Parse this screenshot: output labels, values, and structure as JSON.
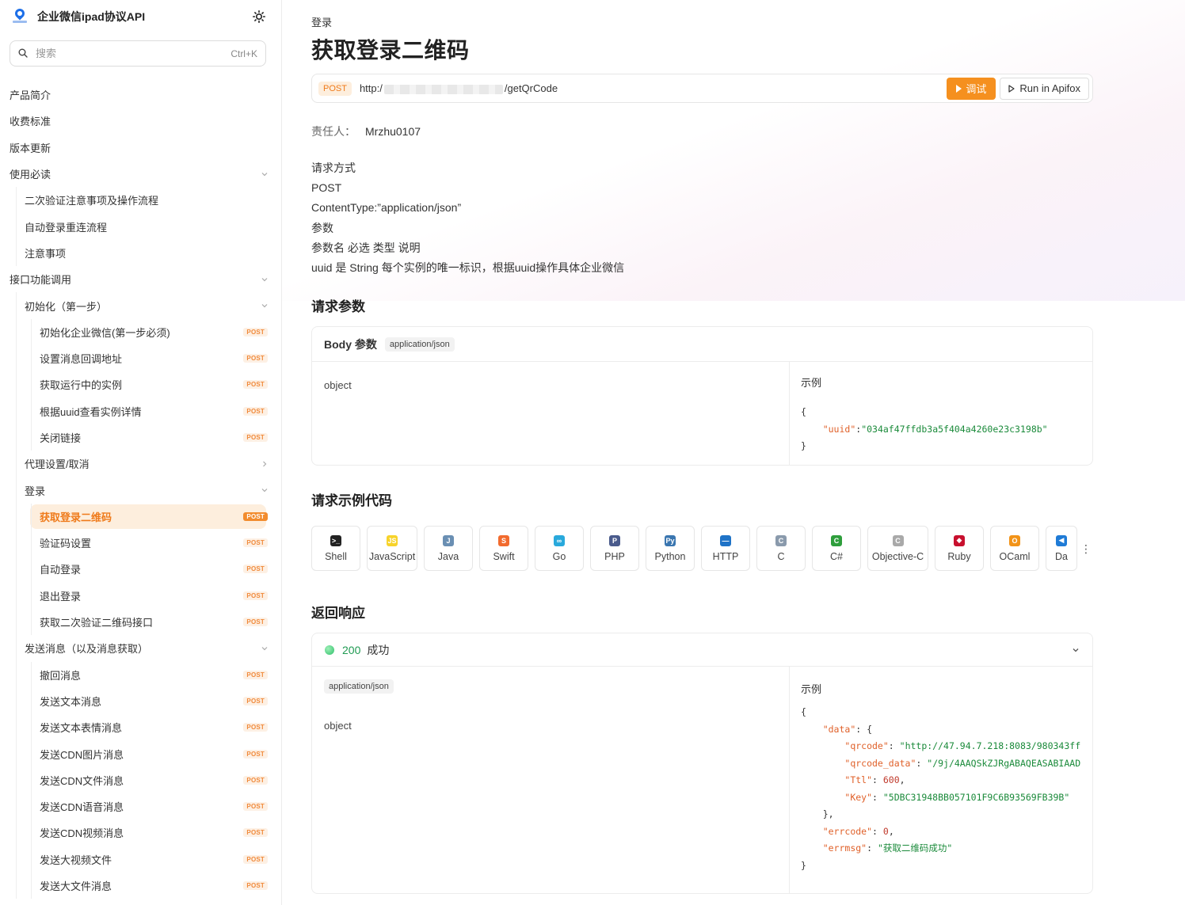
{
  "app": {
    "title": "企业微信ipad协议API"
  },
  "search": {
    "placeholder": "搜索",
    "shortcut": "Ctrl+K"
  },
  "sidebar": {
    "items": [
      {
        "label": "产品简介",
        "level": 0
      },
      {
        "label": "收费标准",
        "level": 0
      },
      {
        "label": "版本更新",
        "level": 0
      },
      {
        "label": "使用必读",
        "level": 0,
        "chevron": "down"
      },
      {
        "label": "二次验证注意事项及操作流程",
        "level": 1
      },
      {
        "label": "自动登录重连流程",
        "level": 1
      },
      {
        "label": "注意事项",
        "level": 1
      },
      {
        "label": "接口功能调用",
        "level": 0,
        "chevron": "down"
      },
      {
        "label": "初始化（第一步）",
        "level": 1,
        "chevron": "down"
      },
      {
        "label": "初始化企业微信(第一步必须)",
        "level": 2,
        "tag": "POST"
      },
      {
        "label": "设置消息回调地址",
        "level": 2,
        "tag": "POST"
      },
      {
        "label": "获取运行中的实例",
        "level": 2,
        "tag": "POST"
      },
      {
        "label": "根据uuid查看实例详情",
        "level": 2,
        "tag": "POST"
      },
      {
        "label": "关闭链接",
        "level": 2,
        "tag": "POST"
      },
      {
        "label": "代理设置/取消",
        "level": 1,
        "chevron": "right"
      },
      {
        "label": "登录",
        "level": 1,
        "chevron": "down"
      },
      {
        "label": "获取登录二维码",
        "level": 2,
        "tag": "POST",
        "active": true
      },
      {
        "label": "验证码设置",
        "level": 2,
        "tag": "POST"
      },
      {
        "label": "自动登录",
        "level": 2,
        "tag": "POST"
      },
      {
        "label": "退出登录",
        "level": 2,
        "tag": "POST"
      },
      {
        "label": "获取二次验证二维码接口",
        "level": 2,
        "tag": "POST"
      },
      {
        "label": "发送消息（以及消息获取）",
        "level": 1,
        "chevron": "down"
      },
      {
        "label": "撤回消息",
        "level": 2,
        "tag": "POST"
      },
      {
        "label": "发送文本消息",
        "level": 2,
        "tag": "POST"
      },
      {
        "label": "发送文本表情消息",
        "level": 2,
        "tag": "POST"
      },
      {
        "label": "发送CDN图片消息",
        "level": 2,
        "tag": "POST"
      },
      {
        "label": "发送CDN文件消息",
        "level": 2,
        "tag": "POST"
      },
      {
        "label": "发送CDN语音消息",
        "level": 2,
        "tag": "POST"
      },
      {
        "label": "发送CDN视频消息",
        "level": 2,
        "tag": "POST"
      },
      {
        "label": "发送大视频文件",
        "level": 2,
        "tag": "POST"
      },
      {
        "label": "发送大文件消息",
        "level": 2,
        "tag": "POST"
      }
    ]
  },
  "main": {
    "breadcrumb": "登录",
    "title": "获取登录二维码",
    "method": "POST",
    "url_prefix": "http:/",
    "url_suffix": "/getQrCode",
    "debug_label": "调试",
    "apifox_label": "Run in Apifox",
    "owner_label": "责任人：",
    "owner_value": "Mrzhu0107",
    "desc_lines": [
      "请求方式",
      "POST",
      "ContentType:”application/json”",
      "参数",
      "参数名 必选 类型 说明",
      "uuid 是 String 每个实例的唯一标识，根据uuid操作具体企业微信"
    ],
    "request_params_title": "请求参数",
    "body_label": "Body 参数",
    "body_content_type": "application/json",
    "body_type": "object",
    "example_label": "示例",
    "request_example": {
      "open": "{",
      "key": "\"uuid\"",
      "value": "\"034af47ffdb3a5f404a4260e23c3198b\"",
      "close": "}"
    },
    "code_section_title": "请求示例代码",
    "languages": [
      {
        "name": "Shell",
        "icon": "shell-icon",
        "color": "#222222"
      },
      {
        "name": "JavaScript",
        "icon": "javascript-icon",
        "color": "#f7d32a"
      },
      {
        "name": "Java",
        "icon": "java-icon",
        "color": "#6a8fb3"
      },
      {
        "name": "Swift",
        "icon": "swift-icon",
        "color": "#f26b2e"
      },
      {
        "name": "Go",
        "icon": "go-icon",
        "color": "#29a9dc"
      },
      {
        "name": "PHP",
        "icon": "php-icon",
        "color": "#4a5b8c"
      },
      {
        "name": "Python",
        "icon": "python-icon",
        "color": "#3a76b0"
      },
      {
        "name": "HTTP",
        "icon": "http-icon",
        "color": "#1f73c7"
      },
      {
        "name": "C",
        "icon": "c-icon",
        "color": "#8a9aac"
      },
      {
        "name": "C#",
        "icon": "csharp-icon",
        "color": "#2e9e3c"
      },
      {
        "name": "Objective-C",
        "icon": "objective-c-icon",
        "color": "#a9a9a9"
      },
      {
        "name": "Ruby",
        "icon": "ruby-icon",
        "color": "#c8102e"
      },
      {
        "name": "OCaml",
        "icon": "ocaml-icon",
        "color": "#f29318"
      },
      {
        "name": "Da",
        "icon": "dart-icon",
        "color": "#1f7bd6"
      }
    ],
    "response_title": "返回响应",
    "response_status_code": "200",
    "response_status_text": "成功",
    "response_content_type": "application/json",
    "response_type": "object",
    "response_example": {
      "open": "{",
      "data_key": "\"data\"",
      "qrcode_key": "\"qrcode\"",
      "qrcode_val": "\"http://47.94.7.218:8083/980343ff",
      "qrcode_data_key": "\"qrcode_data\"",
      "qrcode_data_val": "\"/9j/4AAQSkZJRgABAQEASABIAAD",
      "ttl_key": "\"Ttl\"",
      "ttl_val": "600",
      "key_key": "\"Key\"",
      "key_val": "\"5DBC31948BB057101F9C6B93569FB39B\"",
      "errcode_key": "\"errcode\"",
      "errcode_val": "0",
      "errmsg_key": "\"errmsg\"",
      "errmsg_val": "\"获取二维码成功\"",
      "close": "}"
    }
  },
  "colors": {
    "accent": "#f5901f",
    "active_bg": "#fdeedd",
    "success": "#1f9a52"
  }
}
